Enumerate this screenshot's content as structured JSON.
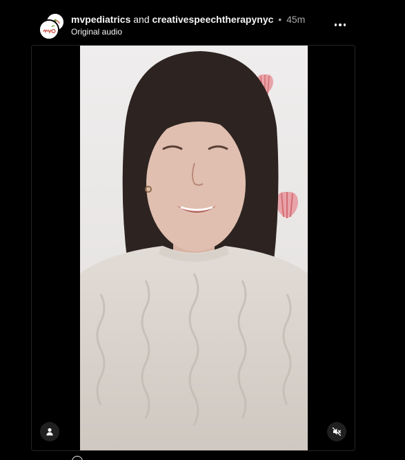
{
  "post": {
    "author": "mvpediatrics",
    "connector": "and",
    "collaborator": "creativespeechtherapynyc",
    "separator": "•",
    "time_ago": "45m",
    "audio_label": "Original audio"
  },
  "icons": {
    "more": "more-options-icon",
    "tag": "user-tag-icon",
    "mute": "speaker-muted-icon",
    "avatar_logo": "mvp-logo-icon"
  },
  "colors": {
    "background": "#000000",
    "text_primary": "#f5f5f5",
    "text_secondary": "#a8a8a8",
    "frame_border": "#262626",
    "button_bg": "#262626"
  }
}
